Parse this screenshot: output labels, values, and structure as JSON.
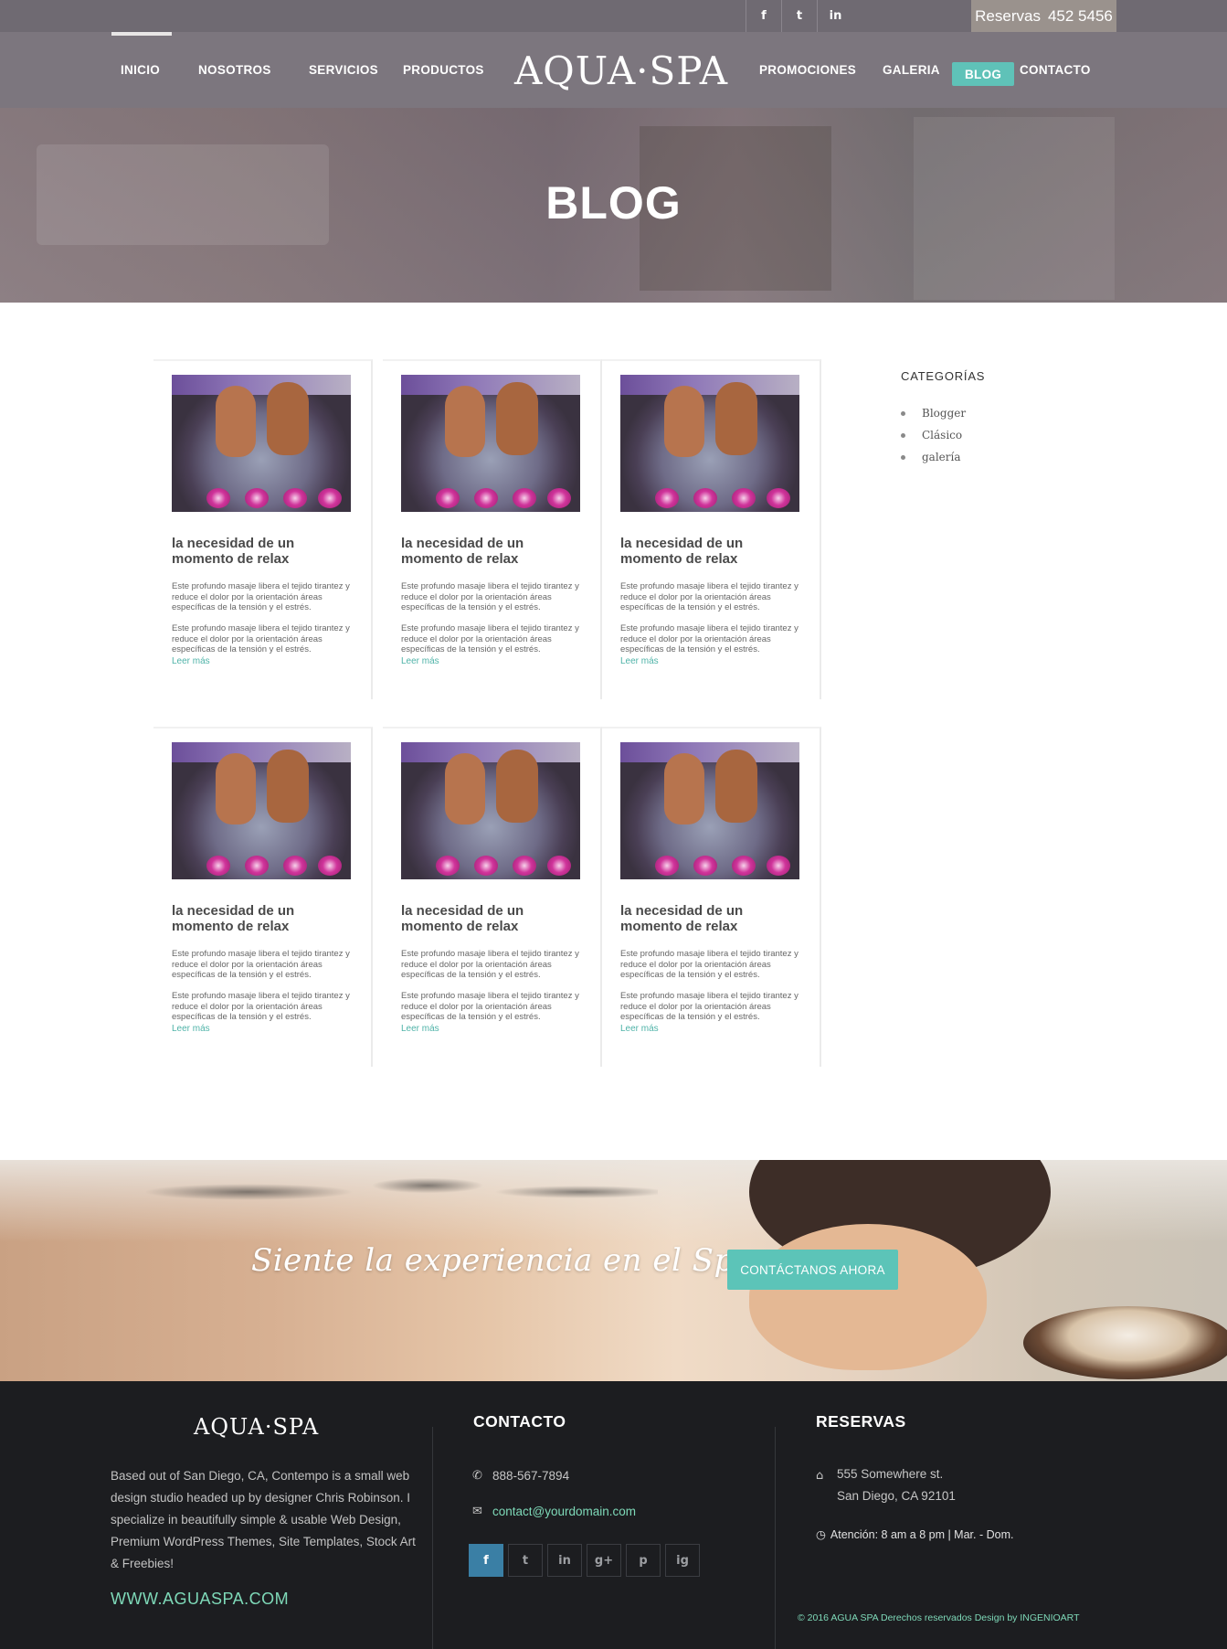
{
  "topbar": {
    "socials": [
      "f",
      "t",
      "in"
    ],
    "reservas_label": "Reservas",
    "reservas_phone": "452 5456"
  },
  "nav": {
    "left": [
      "INICIO",
      "NOSOTROS",
      "SERVICIOS",
      "PRODUCTOS"
    ],
    "logo": "AQUA·SPA",
    "right": [
      "PROMOCIONES",
      "GALERIA",
      "BLOG",
      "CONTACTO"
    ]
  },
  "hero": {
    "title": "BLOG"
  },
  "posts": [
    {
      "title": "la necesidad de un momento de relax",
      "p1": "Este profundo masaje libera el tejido tirantez y reduce el dolor por la orientación áreas específicas de la tensión y el estrés.",
      "p2": "Este profundo masaje libera el tejido tirantez y reduce el dolor por la orientación áreas específicas de la tensión y el estrés.",
      "more": "Leer más"
    },
    {
      "title": "la necesidad de un momento de relax",
      "p1": "Este profundo masaje libera el tejido tirantez y reduce el dolor por la orientación áreas específicas de la tensión y el estrés.",
      "p2": "Este profundo masaje libera el tejido tirantez y reduce el dolor por la orientación áreas específicas de la tensión y el estrés.",
      "more": "Leer más"
    },
    {
      "title": "la necesidad de un momento de relax",
      "p1": "Este profundo masaje libera el tejido tirantez y reduce el dolor por la orientación áreas específicas de la tensión y el estrés.",
      "p2": "Este profundo masaje libera el tejido tirantez y reduce el dolor por la orientación áreas específicas de la tensión y el estrés.",
      "more": "Leer más"
    },
    {
      "title": "la necesidad de un momento de relax",
      "p1": "Este profundo masaje libera el tejido tirantez y reduce el dolor por la orientación áreas específicas de la tensión y el estrés.",
      "p2": "Este profundo masaje libera el tejido tirantez y reduce el dolor por la orientación áreas específicas de la tensión y el estrés.",
      "more": "Leer más"
    },
    {
      "title": "la necesidad de un momento de relax",
      "p1": "Este profundo masaje libera el tejido tirantez y reduce el dolor por la orientación áreas específicas de la tensión y el estrés.",
      "p2": "Este profundo masaje libera el tejido tirantez y reduce el dolor por la orientación áreas específicas de la tensión y el estrés.",
      "more": "Leer más"
    },
    {
      "title": "la necesidad de un momento de relax",
      "p1": "Este profundo masaje libera el tejido tirantez y reduce el dolor por la orientación áreas específicas de la tensión y el estrés.",
      "p2": "Este profundo masaje libera el tejido tirantez y reduce el dolor por la orientación áreas específicas de la tensión y el estrés.",
      "more": "Leer más"
    }
  ],
  "sidebar": {
    "title": "CATEGORÍAS",
    "categories": [
      "Blogger",
      "Clásico",
      "galería"
    ]
  },
  "banner": {
    "script_text": "Siente la experiencia en el Spa",
    "cta": "CONTÁCTANOS  AHORA"
  },
  "footer": {
    "logo": "AQUA·SPA",
    "about": "Based out of San Diego, CA, Contempo is a small web design studio headed up by designer Chris Robinson. I specialize in beautifully simple & usable Web Design, Premium WordPress Themes, Site Templates, Stock Art & Freebies!",
    "url": "WWW.AGUASPA.COM",
    "contact_title": "CONTACTO",
    "phone": "888-567-7894",
    "email": "contact@yourdomain.com",
    "socials": [
      "f",
      "t",
      "in",
      "g+",
      "p",
      "ig"
    ],
    "reservas_title": "RESERVAS",
    "address_line1": "555 Somewhere st.",
    "address_line2": "San Diego, CA 92101",
    "hours": "Atención: 8 am a 8 pm  |  Mar. - Dom.",
    "copyright": "© 2016   AGUA SPA   Derechos reservados Design by INGENIOART"
  },
  "colors": {
    "accent": "#5fc2b8",
    "footer_link": "#7ed9b8",
    "topbar": "#6f6a72",
    "nav": "#7c767e",
    "footer_bg": "#1c1d20"
  }
}
